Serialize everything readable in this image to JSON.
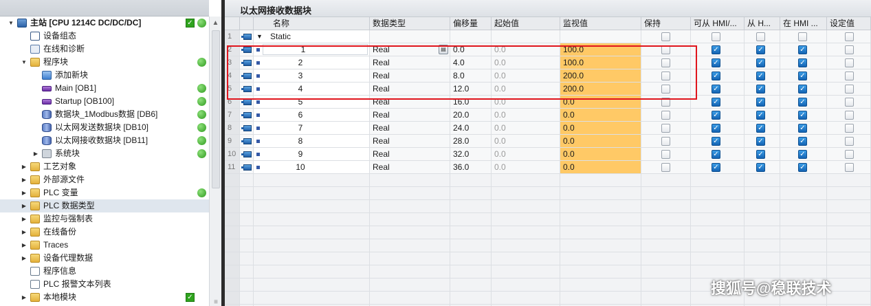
{
  "tree": {
    "station": "主站 [CPU 1214C DC/DC/DC]",
    "items": [
      {
        "label": "设备组态",
        "icon": "device-config-icon",
        "depth": 1
      },
      {
        "label": "在线和诊断",
        "icon": "online-diagnostics-icon",
        "depth": 1
      },
      {
        "label": "程序块",
        "icon": "folder-icon",
        "depth": 1,
        "expanded": true,
        "status": "ok"
      },
      {
        "label": "添加新块",
        "icon": "add-block-icon",
        "depth": 2
      },
      {
        "label": "Main [OB1]",
        "icon": "ob-icon",
        "depth": 2,
        "status": "ok"
      },
      {
        "label": "Startup [OB100]",
        "icon": "ob-icon",
        "depth": 2,
        "status": "ok"
      },
      {
        "label": "数据块_1Modbus数据 [DB6]",
        "icon": "db-icon",
        "depth": 2,
        "status": "ok"
      },
      {
        "label": "以太网发送数据块 [DB10]",
        "icon": "db-icon",
        "depth": 2,
        "status": "ok"
      },
      {
        "label": "以太网接收数据块 [DB11]",
        "icon": "db-icon",
        "depth": 2,
        "status": "ok"
      },
      {
        "label": "系统块",
        "icon": "system-block-icon",
        "depth": 2,
        "collapsed": true,
        "status": "ok"
      },
      {
        "label": "工艺对象",
        "icon": "folder-icon",
        "depth": 1,
        "collapsed": true
      },
      {
        "label": "外部源文件",
        "icon": "folder-icon",
        "depth": 1,
        "collapsed": true
      },
      {
        "label": "PLC 变量",
        "icon": "folder-icon",
        "depth": 1,
        "collapsed": true,
        "status": "ok"
      },
      {
        "label": "PLC 数据类型",
        "icon": "folder-icon",
        "depth": 1,
        "collapsed": true,
        "selected": true
      },
      {
        "label": "监控与强制表",
        "icon": "folder-icon",
        "depth": 1,
        "collapsed": true
      },
      {
        "label": "在线备份",
        "icon": "folder-icon",
        "depth": 1,
        "collapsed": true
      },
      {
        "label": "Traces",
        "icon": "folder-icon",
        "depth": 1,
        "collapsed": true
      },
      {
        "label": "设备代理数据",
        "icon": "folder-icon",
        "depth": 1,
        "collapsed": true
      },
      {
        "label": "程序信息",
        "icon": "program-info-icon",
        "depth": 1
      },
      {
        "label": "PLC 报警文本列表",
        "icon": "document-icon",
        "depth": 1
      },
      {
        "label": "本地模块",
        "icon": "folder-icon",
        "depth": 1,
        "collapsed": true,
        "status": "check"
      }
    ]
  },
  "editor": {
    "title": "以太网接收数据块",
    "columns": [
      "名称",
      "数据类型",
      "偏移量",
      "起始值",
      "监视值",
      "保持",
      "可从 HMI/...",
      "从 H...",
      "在 HMI ...",
      "设定值"
    ],
    "static_row": {
      "num": "1",
      "name": "Static"
    },
    "rows": [
      {
        "num": "2",
        "name": "1",
        "type": "Real",
        "offset": "0.0",
        "start": "0.0",
        "monitor": "100.0"
      },
      {
        "num": "3",
        "name": "2",
        "type": "Real",
        "offset": "4.0",
        "start": "0.0",
        "monitor": "100.0"
      },
      {
        "num": "4",
        "name": "3",
        "type": "Real",
        "offset": "8.0",
        "start": "0.0",
        "monitor": "200.0"
      },
      {
        "num": "5",
        "name": "4",
        "type": "Real",
        "offset": "12.0",
        "start": "0.0",
        "monitor": "200.0"
      },
      {
        "num": "6",
        "name": "5",
        "type": "Real",
        "offset": "16.0",
        "start": "0.0",
        "monitor": "0.0"
      },
      {
        "num": "7",
        "name": "6",
        "type": "Real",
        "offset": "20.0",
        "start": "0.0",
        "monitor": "0.0"
      },
      {
        "num": "8",
        "name": "7",
        "type": "Real",
        "offset": "24.0",
        "start": "0.0",
        "monitor": "0.0"
      },
      {
        "num": "9",
        "name": "8",
        "type": "Real",
        "offset": "28.0",
        "start": "0.0",
        "monitor": "0.0"
      },
      {
        "num": "10",
        "name": "9",
        "type": "Real",
        "offset": "32.0",
        "start": "0.0",
        "monitor": "0.0"
      },
      {
        "num": "11",
        "name": "10",
        "type": "Real",
        "offset": "36.0",
        "start": "0.0",
        "monitor": "0.0"
      }
    ]
  },
  "colors": {
    "monitor_highlight": "#ffc966",
    "status_ok": "#2e9a1e",
    "checkbox_on": "#1464b4",
    "annotation_box": "#e0141c"
  },
  "watermark": "搜狐号@稳联技术"
}
